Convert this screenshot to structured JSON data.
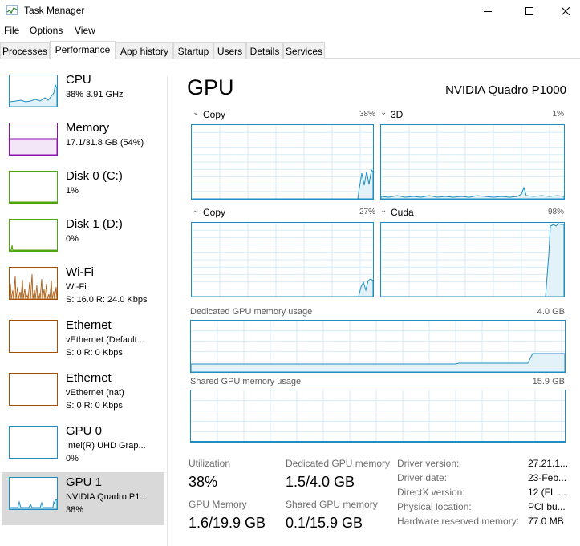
{
  "window": {
    "title": "Task Manager"
  },
  "menu": [
    "File",
    "Options",
    "View"
  ],
  "tabs": [
    "Processes",
    "Performance",
    "App history",
    "Startup",
    "Users",
    "Details",
    "Services"
  ],
  "active_tab": "Performance",
  "colors": {
    "gpu_accent": "#1d8ebf",
    "cpu": "#1d8ebf",
    "memory": "#8b12ae",
    "disk": "#4da60c",
    "network": "#a74f01"
  },
  "sidebar": {
    "cpu": {
      "name": "CPU",
      "line1": "38% 3.91 GHz"
    },
    "memory": {
      "name": "Memory",
      "line1": "17.1/31.8 GB (54%)"
    },
    "disk0": {
      "name": "Disk 0 (C:)",
      "line1": "1%"
    },
    "disk1": {
      "name": "Disk 1 (D:)",
      "line1": "0%"
    },
    "wifi": {
      "name": "Wi-Fi",
      "line1": "Wi-Fi",
      "line2": "S: 16.0  R: 24.0 Kbps"
    },
    "eth1": {
      "name": "Ethernet",
      "line1": "vEthernet (Default...",
      "line2": "S: 0  R: 0 Kbps"
    },
    "eth2": {
      "name": "Ethernet",
      "line1": "vEthernet (nat)",
      "line2": "S: 0  R: 0 Kbps"
    },
    "gpu0": {
      "name": "GPU 0",
      "line1": "Intel(R) UHD Grap...",
      "line2": "0%"
    },
    "gpu1": {
      "name": "GPU 1",
      "line1": "NVIDIA Quadro P1...",
      "line2": "38%"
    }
  },
  "main": {
    "title": "GPU",
    "gpu_name": "NVIDIA Quadro P1000",
    "engines": [
      {
        "name": "Copy",
        "pct": "38%"
      },
      {
        "name": "3D",
        "pct": "1%"
      },
      {
        "name": "Copy",
        "pct": "27%"
      },
      {
        "name": "Cuda",
        "pct": "98%"
      }
    ],
    "dedicated": {
      "label": "Dedicated GPU memory usage",
      "max": "4.0 GB"
    },
    "shared": {
      "label": "Shared GPU memory usage",
      "max": "15.9 GB"
    },
    "stats": {
      "utilization": {
        "label": "Utilization",
        "value": "38%"
      },
      "dedicated_mem": {
        "label": "Dedicated GPU memory",
        "value": "1.5/4.0 GB"
      },
      "gpu_memory": {
        "label": "GPU Memory",
        "value": "1.6/19.9 GB"
      },
      "shared_mem": {
        "label": "Shared GPU memory",
        "value": "0.1/15.9 GB"
      }
    },
    "info": [
      {
        "label": "Driver version:",
        "value": "27.21.1..."
      },
      {
        "label": "Driver date:",
        "value": "23-Feb..."
      },
      {
        "label": "DirectX version:",
        "value": "12 (FL ..."
      },
      {
        "label": "Physical location:",
        "value": "PCI bu..."
      },
      {
        "label": "Hardware reserved memory:",
        "value": "77.0 MB"
      }
    ]
  }
}
